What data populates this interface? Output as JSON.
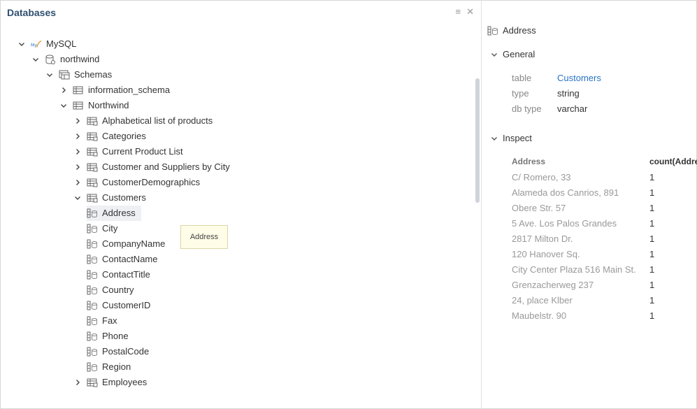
{
  "panel": {
    "title": "Databases"
  },
  "tree": [
    {
      "label": "MySQL",
      "icon": "mysql-logo-icon",
      "expanded": true
    },
    {
      "label": "northwind",
      "icon": "database-icon",
      "expanded": true
    },
    {
      "label": "Schemas",
      "icon": "schemas-icon",
      "expanded": true
    },
    {
      "label": "information_schema",
      "icon": "schema-icon",
      "expanded": false
    },
    {
      "label": "Northwind",
      "icon": "schema-icon",
      "expanded": true
    },
    {
      "label": "Alphabetical list of products",
      "icon": "table-icon",
      "expanded": false
    },
    {
      "label": "Categories",
      "icon": "table-icon",
      "expanded": false
    },
    {
      "label": "Current Product List",
      "icon": "table-icon",
      "expanded": false
    },
    {
      "label": "Customer and Suppliers by City",
      "icon": "table-icon",
      "expanded": false
    },
    {
      "label": "CustomerDemographics",
      "icon": "table-icon",
      "expanded": false
    },
    {
      "label": "Customers",
      "icon": "table-icon",
      "expanded": true
    },
    {
      "label": "Address",
      "icon": "column-icon"
    },
    {
      "label": "City",
      "icon": "column-icon"
    },
    {
      "label": "CompanyName",
      "icon": "column-icon"
    },
    {
      "label": "ContactName",
      "icon": "column-icon"
    },
    {
      "label": "ContactTitle",
      "icon": "column-icon"
    },
    {
      "label": "Country",
      "icon": "column-icon"
    },
    {
      "label": "CustomerID",
      "icon": "column-icon"
    },
    {
      "label": "Fax",
      "icon": "column-icon"
    },
    {
      "label": "Phone",
      "icon": "column-icon"
    },
    {
      "label": "PostalCode",
      "icon": "column-icon"
    },
    {
      "label": "Region",
      "icon": "column-icon"
    },
    {
      "label": "Employees",
      "icon": "table-icon",
      "expanded": false
    }
  ],
  "tooltip": "Address",
  "details": {
    "title": "Address",
    "general_label": "General",
    "props": [
      {
        "key": "table",
        "value": "Customers"
      },
      {
        "key": "type",
        "value": "string"
      },
      {
        "key": "db type",
        "value": "varchar"
      }
    ],
    "inspect_label": "Inspect",
    "inspect_headers": [
      "Address",
      "count(Addre"
    ],
    "inspect_rows": [
      [
        "C/ Romero, 33",
        "1"
      ],
      [
        "Alameda dos Canrios, 891",
        "1"
      ],
      [
        "Obere Str. 57",
        "1"
      ],
      [
        "5 Ave. Los Palos Grandes",
        "1"
      ],
      [
        "2817 Milton Dr.",
        "1"
      ],
      [
        "120 Hanover Sq.",
        "1"
      ],
      [
        "City Center Plaza 516 Main St.",
        "1"
      ],
      [
        "Grenzacherweg 237",
        "1"
      ],
      [
        "24, place Klber",
        "1"
      ],
      [
        "Maubelstr. 90",
        "1"
      ]
    ]
  },
  "colors": {
    "accent": "#2a74c4",
    "title": "#2f4f6f",
    "selection": "#eef0f4",
    "tooltip_bg": "#fffde8"
  }
}
